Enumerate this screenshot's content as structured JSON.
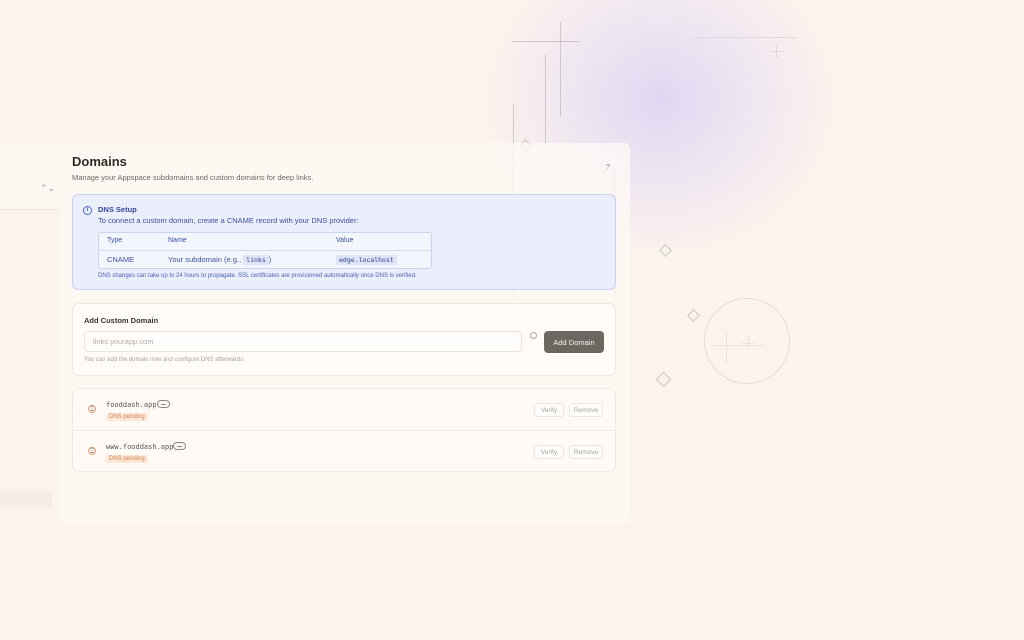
{
  "page": {
    "title": "Domains",
    "subtitle": "Manage your Appspace subdomains and custom domains for deep links.",
    "help_mark": "?"
  },
  "dns_setup": {
    "title": "DNS Setup",
    "description": "To connect a custom domain, create a CNAME record with your DNS provider:",
    "columns": [
      "Type",
      "Name",
      "Value"
    ],
    "record": {
      "type": "CNAME",
      "name_prefix": "Your subdomain (e.g., ",
      "name_example": "links",
      "name_suffix": ")",
      "value": "edge.localhost"
    },
    "note": "DNS changes can take up to 24 hours to propagate. SSL certificates are provisioned automatically once DNS is verified."
  },
  "add_domain": {
    "title": "Add Custom Domain",
    "placeholder": "links.yourapp.com",
    "value": "",
    "button_label": "Add Domain",
    "hint": "You can add the domain now and configure DNS afterwards."
  },
  "domains": [
    {
      "name": "fooddash.app",
      "status": "DNS pending",
      "verify_label": "Verify",
      "remove_label": "Remove"
    },
    {
      "name": "www.fooddash.app",
      "status": "DNS pending",
      "verify_label": "Verify",
      "remove_label": "Remove"
    }
  ],
  "sidebar": {
    "chevron": "⌃⌄"
  },
  "icons": {
    "info": "info-icon",
    "status": "clock-icon",
    "link": "link-icon"
  },
  "colors": {
    "accent_blue": "#34479a",
    "pending_orange": "#d48154",
    "button_dark": "#6d6762",
    "background": "#fcf4ec"
  }
}
